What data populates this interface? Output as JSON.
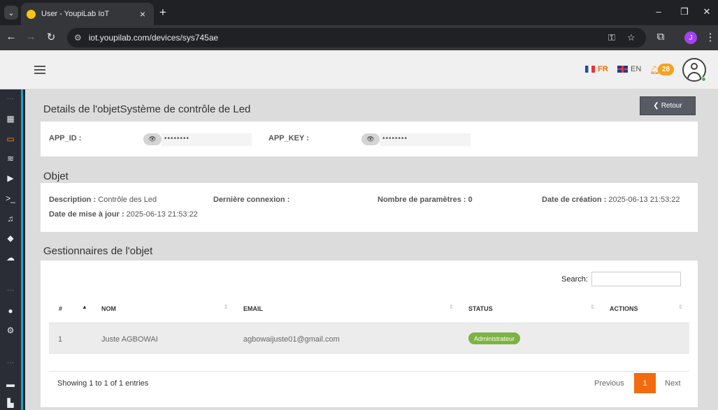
{
  "browser": {
    "tab_title": "User - YoupiLab IoT",
    "url": "iot.youpilab.com/devices/sys745ae",
    "profile_initial": "J"
  },
  "header": {
    "lang_fr": "FR",
    "lang_en": "EN",
    "notification_count": "28"
  },
  "page": {
    "title": "Details de l'objetSystème de contrôle de Led",
    "back_label": "Retour"
  },
  "credentials": {
    "app_id_label": "APP_ID :",
    "app_id_value": "••••••••",
    "app_key_label": "APP_KEY :",
    "app_key_value": "••••••••"
  },
  "object": {
    "section_title": "Objet",
    "description_label": "Description :",
    "description_value": "Contrôle des Led",
    "last_connection_label": "Dernière connexion :",
    "param_count_label": "Nombre de paramètres :",
    "param_count_value": "0",
    "created_label": "Date de création :",
    "created_value": "2025-06-13 21:53:22",
    "updated_label": "Date de mise à jour :",
    "updated_value": "2025-06-13 21:53:22"
  },
  "managers": {
    "section_title": "Gestionnaires de l'objet",
    "search_label": "Search:",
    "columns": [
      "#",
      "NOM",
      "EMAIL",
      "STATUS",
      "ACTIONS"
    ],
    "rows": [
      {
        "num": "1",
        "name": "Juste AGBOWAI",
        "email": "agbowaijuste01@gmail.com",
        "status": "Administrateur"
      }
    ],
    "entries_info": "Showing 1 to 1 of 1 entries",
    "previous_label": "Previous",
    "current_page": "1",
    "next_label": "Next"
  },
  "colors": {
    "accent": "#f26b0f",
    "status_admin": "#7cb342",
    "sidebar": "#2a2d36"
  }
}
